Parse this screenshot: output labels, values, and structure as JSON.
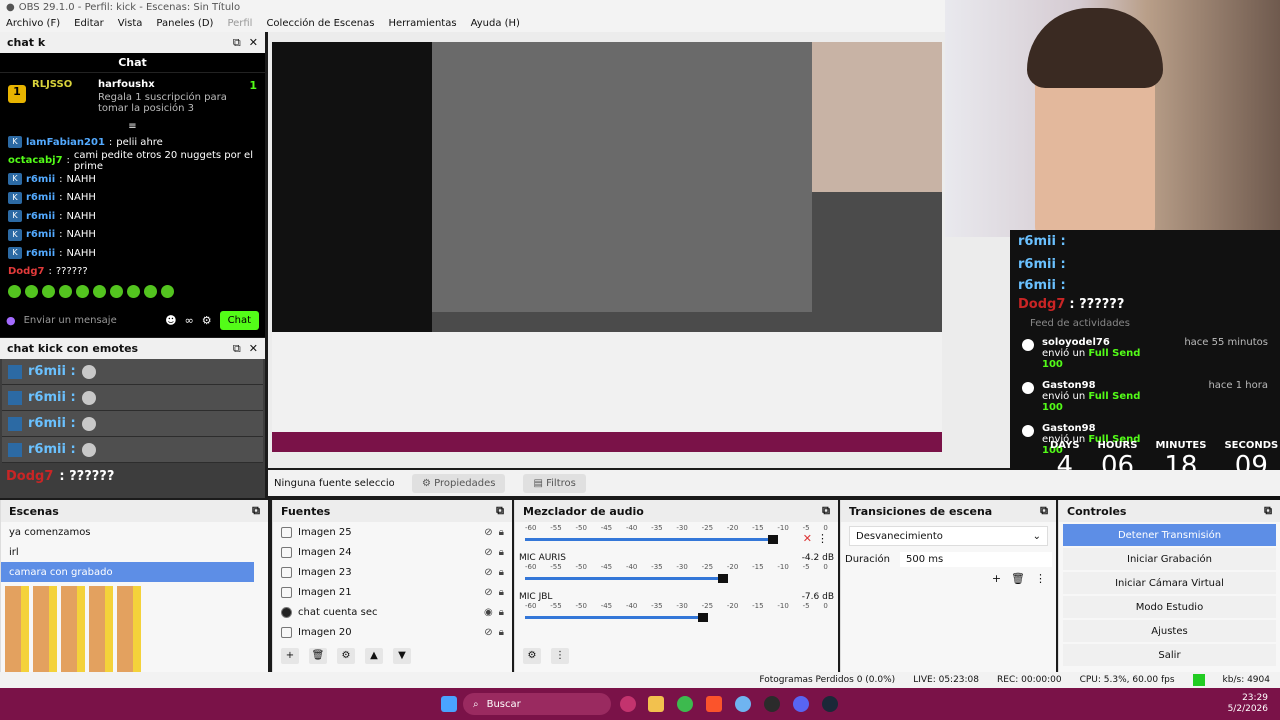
{
  "window_title": "OBS 29.1.0 - Perfil: kick - Escenas: Sin Título",
  "menu": [
    "Archivo (F)",
    "Editar",
    "Vista",
    "Paneles (D)",
    "Perfil",
    "Colección de Escenas",
    "Herramientas",
    "Ayuda (H)"
  ],
  "chat_dock": {
    "title": "chat k",
    "chat_label": "Chat",
    "pinned": {
      "badge": "1",
      "user": "RLJSSO",
      "gifter": "harfoushx",
      "count": "1",
      "text": "Regala 1 suscripción para tomar la posición 3"
    },
    "messages": [
      {
        "user": "lamFabian201",
        "text": "pelii ahre"
      },
      {
        "user": "octacabj7",
        "text": "cami pedite otros 20 nuggets por el prime"
      },
      {
        "user": "r6mii",
        "text": "NAHH"
      },
      {
        "user": "r6mii",
        "text": "NAHH"
      },
      {
        "user": "r6mii",
        "text": "NAHH"
      },
      {
        "user": "r6mii",
        "text": "NAHH"
      },
      {
        "user": "r6mii",
        "text": "NAHH"
      },
      {
        "user": "Dodg7",
        "text": "??????"
      }
    ],
    "input_placeholder": "Enviar un mensaje",
    "send_label": "Chat"
  },
  "emotes_dock": {
    "title": "chat kick con emotes",
    "lines": [
      "r6mii :",
      "r6mii :",
      "r6mii :",
      "r6mii :"
    ],
    "last_user": "Dodg7",
    "last_text": ": ??????"
  },
  "overlay": {
    "emote_user": "r6mii :",
    "red_user": "Dodg7",
    "red_text": ": ??????",
    "feed_title": "Feed de actividades",
    "feed": [
      {
        "name": "soloyodel76",
        "time": "hace 55 minutos",
        "sent": "envió un",
        "item": "Full Send",
        "amount": "100"
      },
      {
        "name": "Gaston98",
        "time": "hace 1 hora",
        "sent": "envió un",
        "item": "Full Send",
        "amount": "100"
      },
      {
        "name": "Gaston98",
        "time": "",
        "sent": "envió un",
        "item": "Full Send",
        "amount": "100"
      }
    ],
    "countdown": {
      "days_label": "DAYS",
      "hours_label": "HOURS",
      "minutes_label": "MINUTES",
      "seconds_label": "SECONDS",
      "days": "4",
      "hours": "06",
      "minutes": "18",
      "seconds": "09"
    }
  },
  "source_bar": {
    "none_selected": "Ninguna fuente seleccionad",
    "properties": "Propiedades",
    "filters": "Filtros"
  },
  "scenes": {
    "title": "Escenas",
    "items": [
      "ya comenzamos",
      "irl",
      "camara con grabado"
    ]
  },
  "sources": {
    "title": "Fuentes",
    "items": [
      "Imagen 25",
      "Imagen 24",
      "Imagen 23",
      "Imagen 21",
      "chat cuenta sec",
      "Imagen 20"
    ]
  },
  "mixer": {
    "title": "Mezclador de audio",
    "scale": [
      "-60",
      "-55",
      "-50",
      "-45",
      "-40",
      "-35",
      "-30",
      "-25",
      "-20",
      "-15",
      "-10",
      "-5",
      "0"
    ],
    "channels": [
      {
        "name": "",
        "db": ""
      },
      {
        "name": "MIC AURIS",
        "db": "-4.2 dB"
      },
      {
        "name": "MIC JBL",
        "db": "-7.6 dB"
      }
    ]
  },
  "transitions": {
    "title": "Transiciones de escena",
    "type": "Desvanecimiento",
    "duration_label": "Duración",
    "duration_value": "500 ms"
  },
  "controls": {
    "title": "Controles",
    "buttons": [
      "Detener Transmisión",
      "Iniciar Grabación",
      "Iniciar Cámara Virtual",
      "Modo Estudio",
      "Ajustes",
      "Salir"
    ]
  },
  "status": {
    "dropped": "Fotogramas Perdidos 0 (0.0%)",
    "live": "LIVE: 05:23:08",
    "rec": "REC: 00:00:00",
    "cpu": "CPU: 5.3%, 60.00 fps",
    "kbs": "kb/s: 4904"
  },
  "taskbar": {
    "search_label": "Buscar",
    "time": "23:29",
    "date": "5/2/2026"
  },
  "colors": {
    "kick_green": "#53fc18",
    "taskbar": "#7a1248",
    "accent_blue": "#5d8ee6"
  }
}
